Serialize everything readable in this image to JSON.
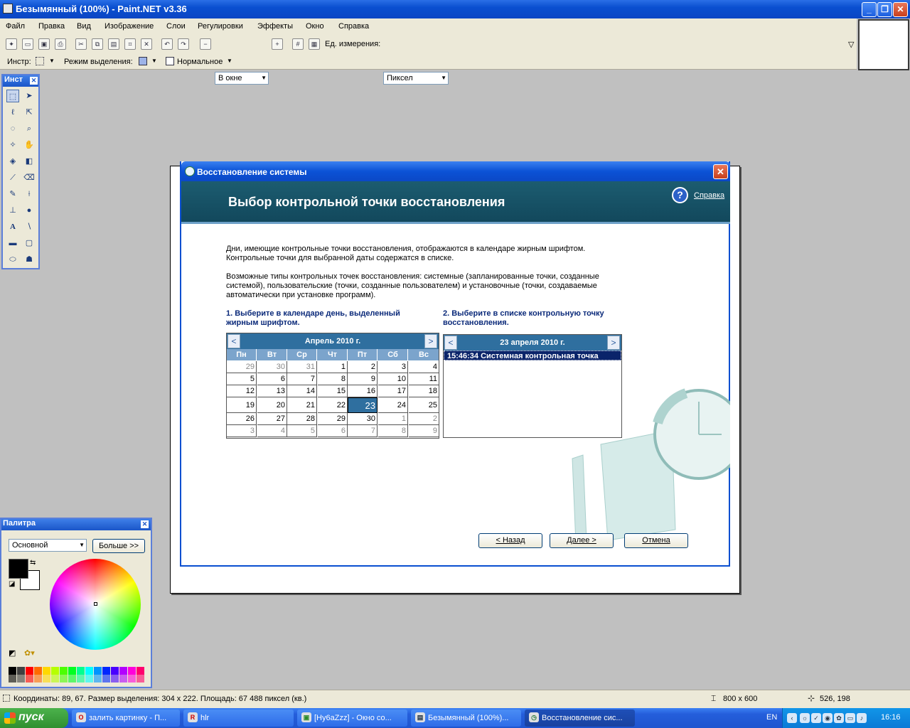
{
  "window": {
    "title": "Безымянный (100%) - Paint.NET v3.36"
  },
  "menu": [
    "Файл",
    "Правка",
    "Вид",
    "Изображение",
    "Слои",
    "Регулировки",
    "Эффекты",
    "Окно",
    "Справка"
  ],
  "toolbar1": {
    "zoom_value": "В окне",
    "units_label": "Ед. измерения:",
    "units_value": "Пиксел"
  },
  "toolbar2": {
    "tool_label": "Инстр:",
    "selection_mode_label": "Режим выделения:",
    "blend_value": "Нормальное"
  },
  "tools_panel": {
    "title": "Инст"
  },
  "palette_panel": {
    "title": "Палитра",
    "palette_value": "Основной",
    "more_button": "Больше >>"
  },
  "palette_colors": [
    "#000000",
    "#404040",
    "#ff0000",
    "#ff6a00",
    "#ffd800",
    "#b6ff00",
    "#4cff00",
    "#00ff21",
    "#00ff90",
    "#00ffff",
    "#0094ff",
    "#0026ff",
    "#4800ff",
    "#b200ff",
    "#ff00dc",
    "#ff006e"
  ],
  "dialog": {
    "title": "Восстановление системы",
    "heading": "Выбор контрольной точки восстановления",
    "help_link": "Справка",
    "desc1_line1": "Дни, имеющие контрольные точки восстановления, отображаются в календаре жирным шрифтом.",
    "desc1_line2": "Контрольные точки для выбранной даты содержатся в списке.",
    "desc2_line1": "Возможные типы контрольных точек восстановления: системные (запланированные точки, созданные",
    "desc2_line2": "системой), пользовательские (точки, созданные пользователем) и установочные (точки, создаваемые",
    "desc2_line3": "автоматически при установке программ).",
    "step1_line1": "1. Выберите в календаре день, выделенный",
    "step1_line2": "жирным шрифтом.",
    "step2_line1": "2. Выберите в списке контрольную точку",
    "step2_line2": "восстановления.",
    "calendar": {
      "month": "Апрель 2010 г.",
      "prev": "<",
      "next": ">",
      "dow": [
        "Пн",
        "Вт",
        "Ср",
        "Чт",
        "Пт",
        "Сб",
        "Вс"
      ],
      "weeks": [
        [
          "29",
          "30",
          "31",
          "1",
          "2",
          "3",
          "4"
        ],
        [
          "5",
          "6",
          "7",
          "8",
          "9",
          "10",
          "11"
        ],
        [
          "12",
          "13",
          "14",
          "15",
          "16",
          "17",
          "18"
        ],
        [
          "19",
          "20",
          "21",
          "22",
          "23",
          "24",
          "25"
        ],
        [
          "26",
          "27",
          "28",
          "29",
          "30",
          "1",
          "2"
        ],
        [
          "3",
          "4",
          "5",
          "6",
          "7",
          "8",
          "9"
        ]
      ]
    },
    "list": {
      "date": "23 апреля 2010 г.",
      "prev": "<",
      "next": ">",
      "item": "15:46:34  Системная контрольная точка"
    },
    "buttons": {
      "back": "< Назад",
      "next": "Далее >",
      "cancel": "Отмена"
    }
  },
  "status": {
    "coords": "Координаты: 89, 67. Размер выделения: 304 x 222. Площадь: 67 488 пиксел (кв.)",
    "size": "800 x 600",
    "cursor": "526, 198"
  },
  "taskbar": {
    "start": "пуск",
    "tasks": [
      "залить картинку - П...",
      "hlr",
      "[Ну6аZzz] - Окно со...",
      "Безымянный (100%)...",
      "Восстановление сис..."
    ],
    "lang": "EN",
    "clock": "16:16"
  }
}
